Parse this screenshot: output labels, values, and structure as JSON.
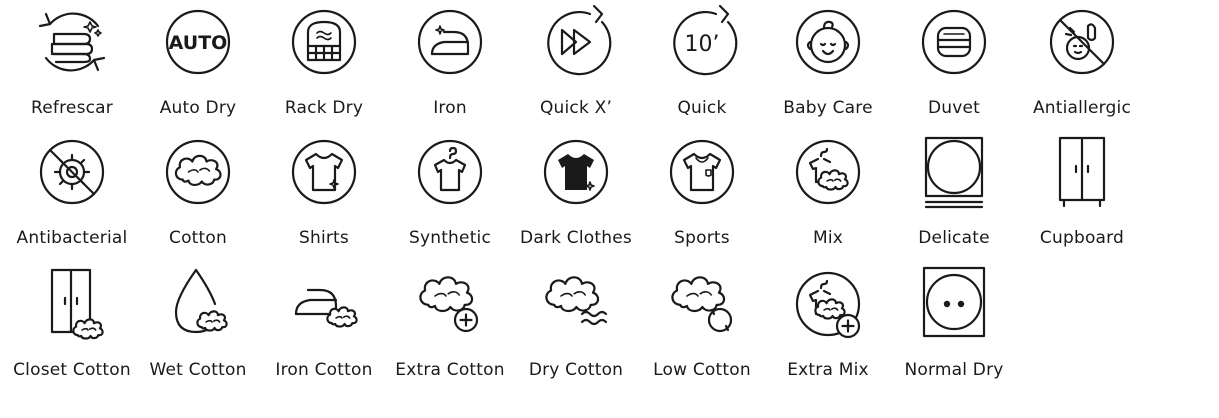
{
  "programs": [
    {
      "label": "Refrescar",
      "icon": "refresh-towels-icon"
    },
    {
      "label": "Auto Dry",
      "icon": "auto-icon"
    },
    {
      "label": "Rack Dry",
      "icon": "rack-icon"
    },
    {
      "label": "Iron",
      "icon": "iron-icon"
    },
    {
      "label": "Quick X’",
      "icon": "fast-forward-icon"
    },
    {
      "label": "Quick",
      "icon": "ten-minutes-icon"
    },
    {
      "label": "Baby Care",
      "icon": "baby-face-icon"
    },
    {
      "label": "Duvet",
      "icon": "duvet-icon"
    },
    {
      "label": "Antiallergic",
      "icon": "antiallergic-icon"
    },
    {
      "label": "Antibacterial",
      "icon": "antibacterial-icon"
    },
    {
      "label": "Cotton",
      "icon": "cotton-icon"
    },
    {
      "label": "Shirts",
      "icon": "shirt-icon"
    },
    {
      "label": "Synthetic",
      "icon": "hanger-shirt-icon"
    },
    {
      "label": "Dark Clothes",
      "icon": "dark-shirt-icon"
    },
    {
      "label": "Sports",
      "icon": "sports-jersey-icon"
    },
    {
      "label": "Mix",
      "icon": "mix-icon"
    },
    {
      "label": "Delicate",
      "icon": "delicate-square-icon"
    },
    {
      "label": "Cupboard",
      "icon": "cupboard-icon"
    },
    {
      "label": "Closet Cotton",
      "icon": "closet-cotton-icon"
    },
    {
      "label": "Wet Cotton",
      "icon": "droplet-cotton-icon"
    },
    {
      "label": "Iron Cotton",
      "icon": "iron-cotton-icon"
    },
    {
      "label": "Extra Cotton",
      "icon": "cotton-plus-icon"
    },
    {
      "label": "Dry Cotton",
      "icon": "cotton-wind-icon"
    },
    {
      "label": "Low Cotton",
      "icon": "cotton-cycle-icon"
    },
    {
      "label": "Extra Mix",
      "icon": "mix-plus-icon"
    },
    {
      "label": "Normal Dry",
      "icon": "two-dots-square-icon"
    }
  ],
  "colors": {
    "ink": "#1a1a1a",
    "background": "#ffffff"
  },
  "icon_text": {
    "auto": "AUTO",
    "ten": "10’"
  }
}
